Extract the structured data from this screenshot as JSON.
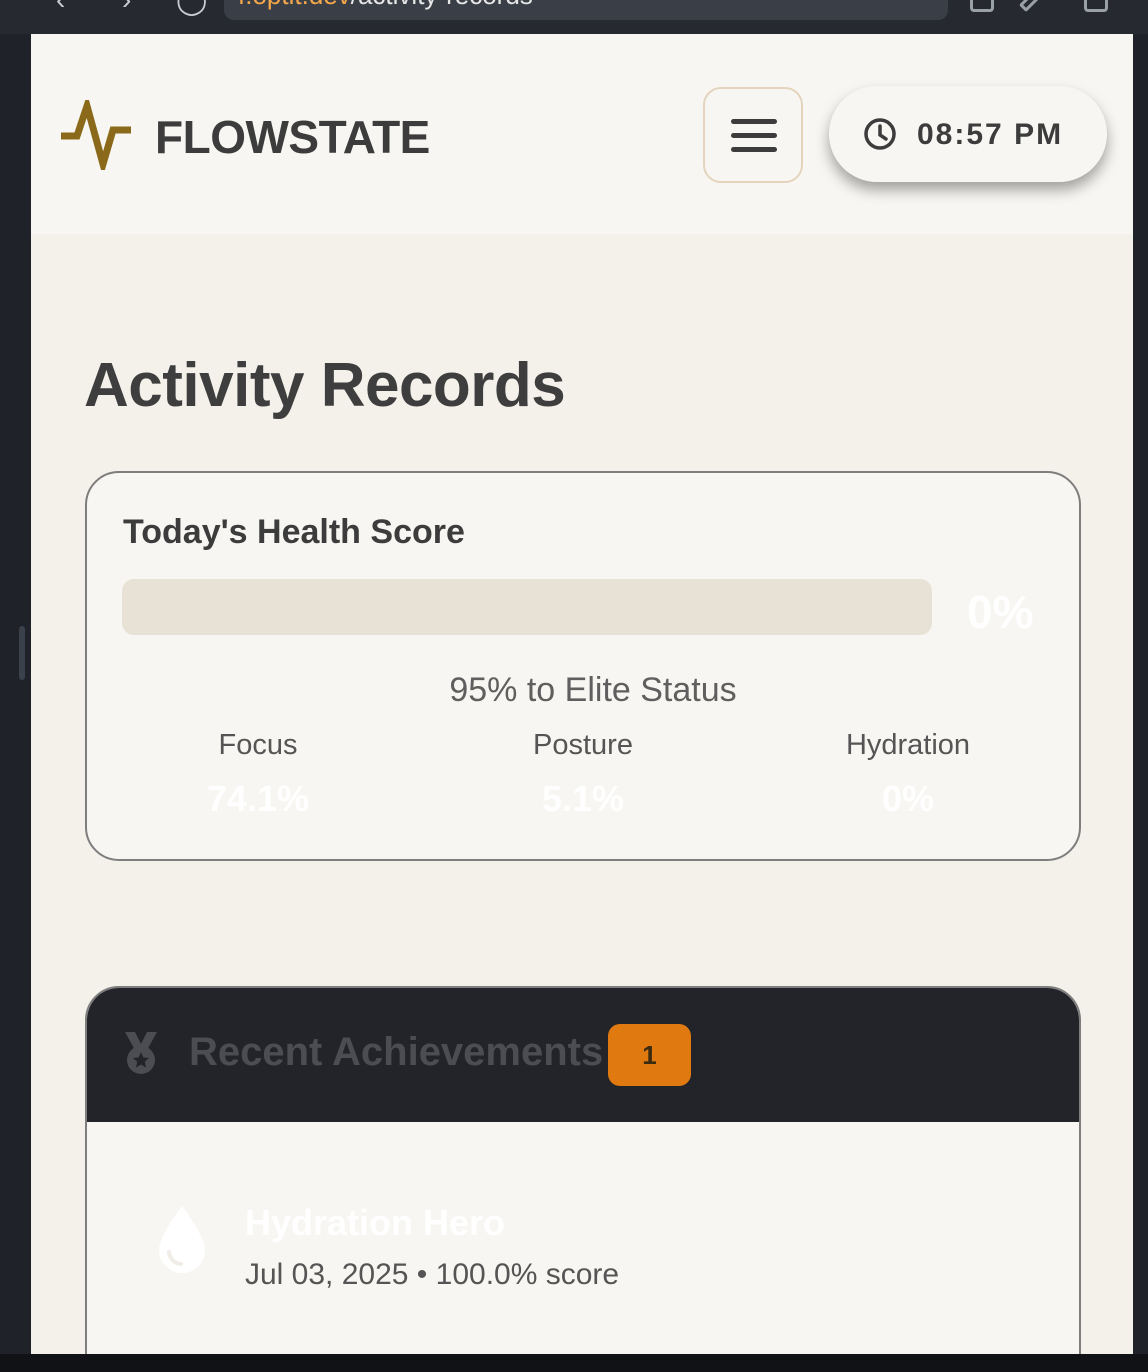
{
  "browser": {
    "url_host": "f.optit.dev",
    "url_path": "/activity-records"
  },
  "header": {
    "brand": "FLOWSTATE",
    "time": "08:57 PM"
  },
  "page": {
    "title": "Activity Records"
  },
  "health_card": {
    "title": "Today's Health Score",
    "progress_value": 0,
    "progress_label": "0%",
    "elite_text": "95% to Elite Status",
    "metrics": [
      {
        "label": "Focus",
        "value": "74.1%"
      },
      {
        "label": "Posture",
        "value": "5.1%"
      },
      {
        "label": "Hydration",
        "value": "0%"
      }
    ]
  },
  "achievements": {
    "title": "Recent Achievements",
    "count": "1",
    "items": [
      {
        "title": "Hydration Hero",
        "meta": "Jul 03, 2025 • 100.0% score",
        "icon": "droplet-icon"
      }
    ]
  },
  "colors": {
    "accent": "#8a6a1a",
    "badge": "#e07a10",
    "dark_header": "#222429"
  }
}
